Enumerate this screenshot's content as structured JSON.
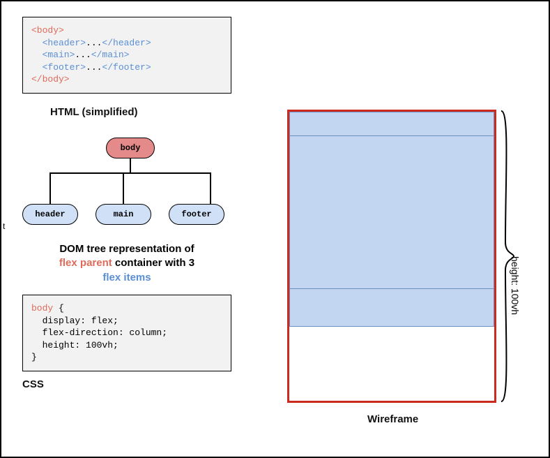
{
  "html_code": {
    "l1a": "<body>",
    "l1_color": "red",
    "l2a": "  <header>",
    "l2b": "...",
    "l2c": "</header>",
    "l3a": "  <main>",
    "l3b": "...",
    "l3c": "</main>",
    "l4a": "  <footer>",
    "l4b": "...",
    "l4c": "</footer>",
    "l5a": "</body>"
  },
  "html_label": "HTML (simplified)",
  "tree": {
    "root": "body",
    "children": [
      "header",
      "main",
      "footer"
    ]
  },
  "tree_caption": {
    "line1": "DOM tree representation of",
    "flex_parent": "flex parent",
    "mid": " container with 3",
    "flex_items": "flex items"
  },
  "css_code": {
    "selector": "body",
    "brace_open": " {",
    "l1": "  display: flex;",
    "l2": "  flex-direction: column;",
    "l3": "  height: 100vh;",
    "brace_close": "}"
  },
  "css_label": "CSS",
  "wireframe_label": "Wireframe",
  "brace_label": "height: 100vh",
  "stray": "t"
}
